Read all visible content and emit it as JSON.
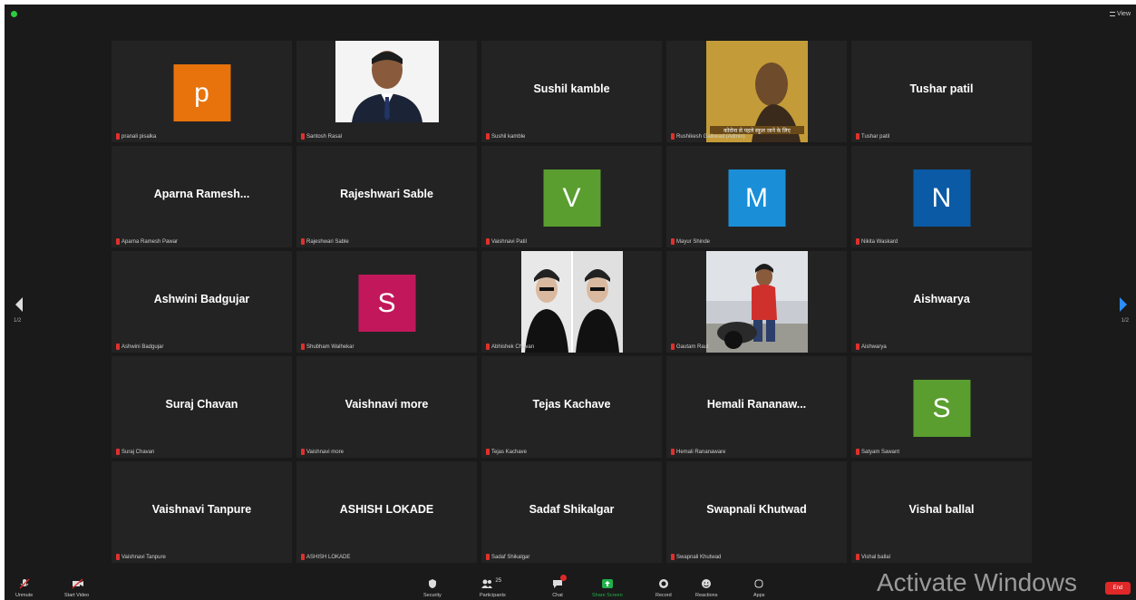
{
  "window": {
    "view_label": "View"
  },
  "pagination": {
    "left_page": "1/2",
    "right_page": "1/2"
  },
  "tiles": [
    {
      "display": "avatar",
      "letter": "p",
      "avatar_color": "#e8730c",
      "caption": "pranali pisalka"
    },
    {
      "display": "photo",
      "photo": "suit-man",
      "caption": "Santosh Rasal"
    },
    {
      "display": "name",
      "name": "Sushil kamble",
      "caption": "Sushil kamble"
    },
    {
      "display": "photo",
      "photo": "meme",
      "caption": "Rushikesh Gaikwad (Admin)"
    },
    {
      "display": "name",
      "name": "Tushar patil",
      "caption": "Tushar patil"
    },
    {
      "display": "name",
      "name": "Aparna  Ramesh...",
      "caption": "Aparna Ramesh Pawar"
    },
    {
      "display": "name",
      "name": "Rajeshwari Sable",
      "caption": "Rajeshwari Sable"
    },
    {
      "display": "avatar",
      "letter": "V",
      "avatar_color": "#5a9e2f",
      "caption": "Vaishnavi Patil"
    },
    {
      "display": "avatar",
      "letter": "M",
      "avatar_color": "#1a8fd8",
      "caption": "Mayur Shinde"
    },
    {
      "display": "avatar",
      "letter": "N",
      "avatar_color": "#0b5aa6",
      "caption": "Nikita Waskard"
    },
    {
      "display": "name",
      "name": "Ashwini Badgujar",
      "caption": "Ashwini Badgujar"
    },
    {
      "display": "avatar",
      "letter": "S",
      "avatar_color": "#c2185b",
      "caption": "Shubham Walhekar"
    },
    {
      "display": "photo",
      "photo": "two-men",
      "caption": "Abhishek Chavan"
    },
    {
      "display": "photo",
      "photo": "bike-man",
      "caption": "Gautam Raut"
    },
    {
      "display": "name",
      "name": "Aishwarya",
      "caption": "Aishwarya"
    },
    {
      "display": "name",
      "name": "Suraj Chavan",
      "caption": "Suraj Chavan"
    },
    {
      "display": "name",
      "name": "Vaishnavi more",
      "caption": "Vaishnavi more"
    },
    {
      "display": "name",
      "name": "Tejas Kachave",
      "caption": "Tejas Kachave"
    },
    {
      "display": "name",
      "name": "Hemali  Rananaw...",
      "caption": "Hemali Rananaware"
    },
    {
      "display": "avatar",
      "letter": "S",
      "avatar_color": "#5a9e2f",
      "caption": "Satyam Sawant"
    },
    {
      "display": "name",
      "name": "Vaishnavi Tanpure",
      "caption": "Vaishnavi Tanpure"
    },
    {
      "display": "name",
      "name": "ASHISH LOKADE",
      "caption": "ASHISH LOKADE"
    },
    {
      "display": "name",
      "name": "Sadaf Shikalgar",
      "caption": "Sadaf Shikalgar"
    },
    {
      "display": "name",
      "name": "Swapnali Khutwad",
      "caption": "Swapnali Khutwad"
    },
    {
      "display": "name",
      "name": "Vishal ballal",
      "caption": "Vishal ballal"
    }
  ],
  "toolbar": {
    "unmute": "Unmute",
    "start_video": "Start Video",
    "security": "Security",
    "participants": "Participants",
    "participants_count": "25",
    "chat": "Chat",
    "share_screen": "Share Screen",
    "record": "Record",
    "reactions": "Reactions",
    "apps": "Apps",
    "end": "End"
  },
  "watermark": "Activate Windows",
  "colors": {
    "background": "#1a1a1a",
    "tile": "#232323",
    "accent": "#2d8cff",
    "share": "#21b14a",
    "end": "#e02828"
  }
}
